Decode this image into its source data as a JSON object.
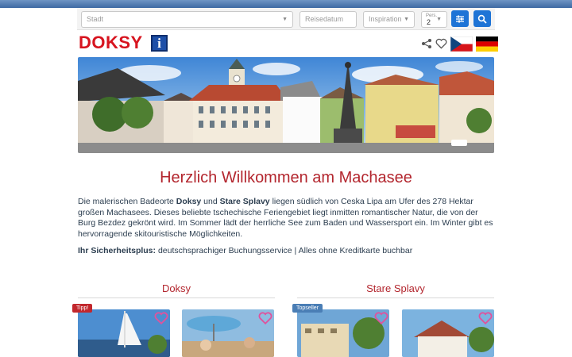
{
  "search": {
    "city_placeholder": "Stadt",
    "date_placeholder": "Reisedatum",
    "inspiration_placeholder": "Inspiration",
    "persons_label": "Pers.",
    "persons_value": "2"
  },
  "brand": {
    "logo_text": "DOKSY",
    "info_glyph": "i"
  },
  "colors": {
    "accent_blue": "#1e74d6",
    "brand_red": "#d7141f",
    "heading_red": "#b3262e"
  },
  "main": {
    "title": "Herzlich Willkommen am Machasee",
    "intro": {
      "p1": "Die malerischen Badeorte ",
      "p1_bold1": "Doksy",
      "p2": " und ",
      "p2_bold2": "Stare Splavy",
      "p3": " liegen südlich von Ceska Lipa am Ufer des 278 Hektar großen Machasees. Dieses beliebte tschechische Feriengebiet liegt inmitten romantischer Natur, die von der Burg Bezdez gekrönt wird. Im Sommer lädt der herrliche See zum Baden und Wassersport ein. Im Winter gibt es hervorragende skitouristische Möglichkeiten."
    },
    "safety_label": "Ihr Sicherheitsplus:",
    "safety_text": " deutschsprachiger Buchungsservice | Alles ohne Kreditkarte buchbar"
  },
  "sections": [
    {
      "title": "Doksy"
    },
    {
      "title": "Stare Splavy"
    }
  ],
  "badges": {
    "tip": "Tipp!",
    "topseller": "Topseller"
  }
}
